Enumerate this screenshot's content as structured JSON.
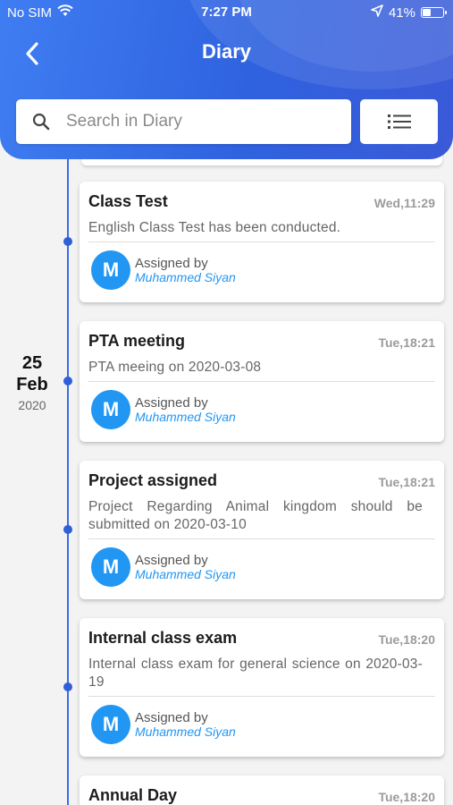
{
  "status_bar": {
    "carrier": "No SIM",
    "time": "7:27 PM",
    "battery": "41%",
    "battery_level": 0.41
  },
  "header": {
    "title": "Diary"
  },
  "search": {
    "placeholder": "Search in Diary",
    "value": ""
  },
  "date_group": {
    "day": "25",
    "month": "Feb",
    "year": "2020"
  },
  "assigned_by_label": "Assigned by",
  "avatar_initial": "M",
  "entries": [
    {
      "title": "Class Test",
      "time": "Wed,11:29",
      "description": "English Class Test has been conducted.",
      "assigned_by": "Muhammed Siyan"
    },
    {
      "title": "PTA meeting",
      "time": "Tue,18:21",
      "description": "PTA meeing on 2020-03-08",
      "assigned_by": "Muhammed Siyan"
    },
    {
      "title": "Project assigned",
      "time": "Tue,18:21",
      "description": "Project Regarding Animal kingdom should be submitted on 2020-03-10",
      "assigned_by": "Muhammed Siyan"
    },
    {
      "title": "Internal class exam",
      "time": "Tue,18:20",
      "description": "Internal class exam for general science on 2020-03-19",
      "assigned_by": "Muhammed Siyan"
    },
    {
      "title": "Annual Day",
      "time": "Tue,18:20"
    }
  ],
  "colors": {
    "header_gradient_start": "#3f7df2",
    "header_gradient_end": "#3a5ad8",
    "timeline": "#3d6ee8",
    "avatar": "#2196f3",
    "assigned_name": "#2196f3"
  }
}
